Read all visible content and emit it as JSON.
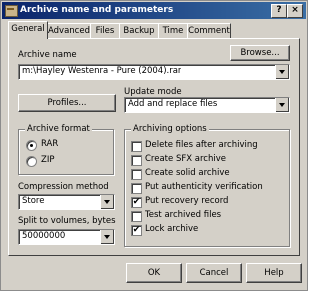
{
  "window": {
    "title": "Archive name and parameters",
    "help_glyph": "?",
    "close_glyph": "×"
  },
  "tabs": [
    {
      "label": "General",
      "active": true
    },
    {
      "label": "Advanced",
      "active": false
    },
    {
      "label": "Files",
      "active": false
    },
    {
      "label": "Backup",
      "active": false
    },
    {
      "label": "Time",
      "active": false
    },
    {
      "label": "Comment",
      "active": false
    }
  ],
  "archive_name": {
    "label": "Archive name",
    "browse_label": "Browse...",
    "value": "m:\\Hayley Westenra - Pure (2004).rar"
  },
  "profiles_label": "Profiles...",
  "update_mode": {
    "label": "Update mode",
    "value": "Add and replace files"
  },
  "archive_format": {
    "label": "Archive format",
    "options": [
      {
        "label": "RAR",
        "checked": true
      },
      {
        "label": "ZIP",
        "checked": false
      }
    ]
  },
  "compression": {
    "label": "Compression method",
    "value": "Store"
  },
  "split": {
    "label": "Split to volumes, bytes",
    "value": "50000000"
  },
  "archiving_options": {
    "label": "Archiving options",
    "items": [
      {
        "label": "Delete files after archiving",
        "checked": false
      },
      {
        "label": "Create SFX archive",
        "checked": false
      },
      {
        "label": "Create solid archive",
        "checked": false
      },
      {
        "label": "Put authenticity verification",
        "checked": false
      },
      {
        "label": "Put recovery record",
        "checked": true
      },
      {
        "label": "Test archived files",
        "checked": false
      },
      {
        "label": "Lock archive",
        "checked": true
      }
    ]
  },
  "buttons": {
    "ok": "OK",
    "cancel": "Cancel",
    "help": "Help"
  },
  "check_glyph": "✔"
}
